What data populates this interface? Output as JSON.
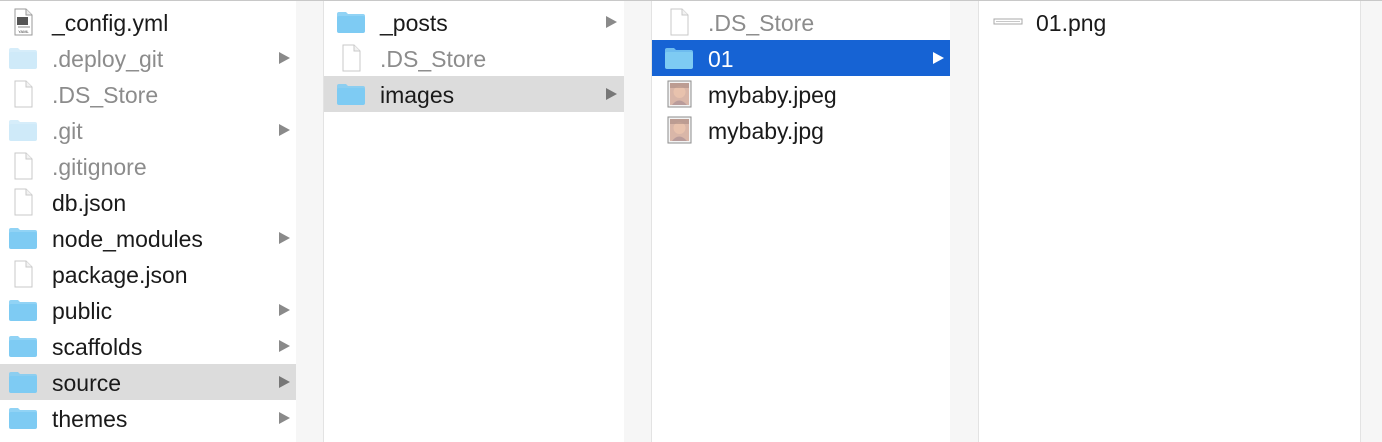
{
  "colors": {
    "folder": "#7ecbf3",
    "folder_faded": "#cfeaf9",
    "selected_blue": "#1663d4",
    "selected_gray": "#dcdcdc"
  },
  "columns": [
    {
      "items": [
        {
          "name": "_config.yml",
          "icon": "yaml-file-icon",
          "dim": false,
          "folder": false,
          "arrow": false,
          "selected": "none",
          "icon_label": "YAML"
        },
        {
          "name": ".deploy_git",
          "icon": "folder-icon",
          "dim": true,
          "folder": true,
          "arrow": true,
          "selected": "none"
        },
        {
          "name": ".DS_Store",
          "icon": "document-icon",
          "dim": true,
          "folder": false,
          "arrow": false,
          "selected": "none"
        },
        {
          "name": ".git",
          "icon": "folder-icon",
          "dim": true,
          "folder": true,
          "arrow": true,
          "selected": "none"
        },
        {
          "name": ".gitignore",
          "icon": "document-icon",
          "dim": true,
          "folder": false,
          "arrow": false,
          "selected": "none"
        },
        {
          "name": "db.json",
          "icon": "document-icon",
          "dim": false,
          "folder": false,
          "arrow": false,
          "selected": "none"
        },
        {
          "name": "node_modules",
          "icon": "folder-icon",
          "dim": false,
          "folder": true,
          "arrow": true,
          "selected": "none"
        },
        {
          "name": "package.json",
          "icon": "document-icon",
          "dim": false,
          "folder": false,
          "arrow": false,
          "selected": "none"
        },
        {
          "name": "public",
          "icon": "folder-icon",
          "dim": false,
          "folder": true,
          "arrow": true,
          "selected": "none"
        },
        {
          "name": "scaffolds",
          "icon": "folder-icon",
          "dim": false,
          "folder": true,
          "arrow": true,
          "selected": "none"
        },
        {
          "name": "source",
          "icon": "folder-icon",
          "dim": false,
          "folder": true,
          "arrow": true,
          "selected": "gray"
        },
        {
          "name": "themes",
          "icon": "folder-icon",
          "dim": false,
          "folder": true,
          "arrow": true,
          "selected": "none"
        }
      ]
    },
    {
      "items": [
        {
          "name": "_posts",
          "icon": "folder-icon",
          "dim": false,
          "folder": true,
          "arrow": true,
          "selected": "none"
        },
        {
          "name": ".DS_Store",
          "icon": "document-icon",
          "dim": true,
          "folder": false,
          "arrow": false,
          "selected": "none"
        },
        {
          "name": "images",
          "icon": "folder-icon",
          "dim": false,
          "folder": true,
          "arrow": true,
          "selected": "gray"
        }
      ]
    },
    {
      "items": [
        {
          "name": ".DS_Store",
          "icon": "document-icon",
          "dim": true,
          "folder": false,
          "arrow": false,
          "selected": "none"
        },
        {
          "name": "01",
          "icon": "folder-icon",
          "dim": false,
          "folder": true,
          "arrow": true,
          "selected": "blue"
        },
        {
          "name": "mybaby.jpeg",
          "icon": "image-thumbnail-icon",
          "dim": false,
          "folder": false,
          "arrow": false,
          "selected": "none"
        },
        {
          "name": "mybaby.jpg",
          "icon": "image-thumbnail-icon",
          "dim": false,
          "folder": false,
          "arrow": false,
          "selected": "none"
        }
      ]
    },
    {
      "items": [
        {
          "name": "01.png",
          "icon": "png-thumbnail-icon",
          "dim": false,
          "folder": false,
          "arrow": false,
          "selected": "none"
        }
      ]
    }
  ]
}
